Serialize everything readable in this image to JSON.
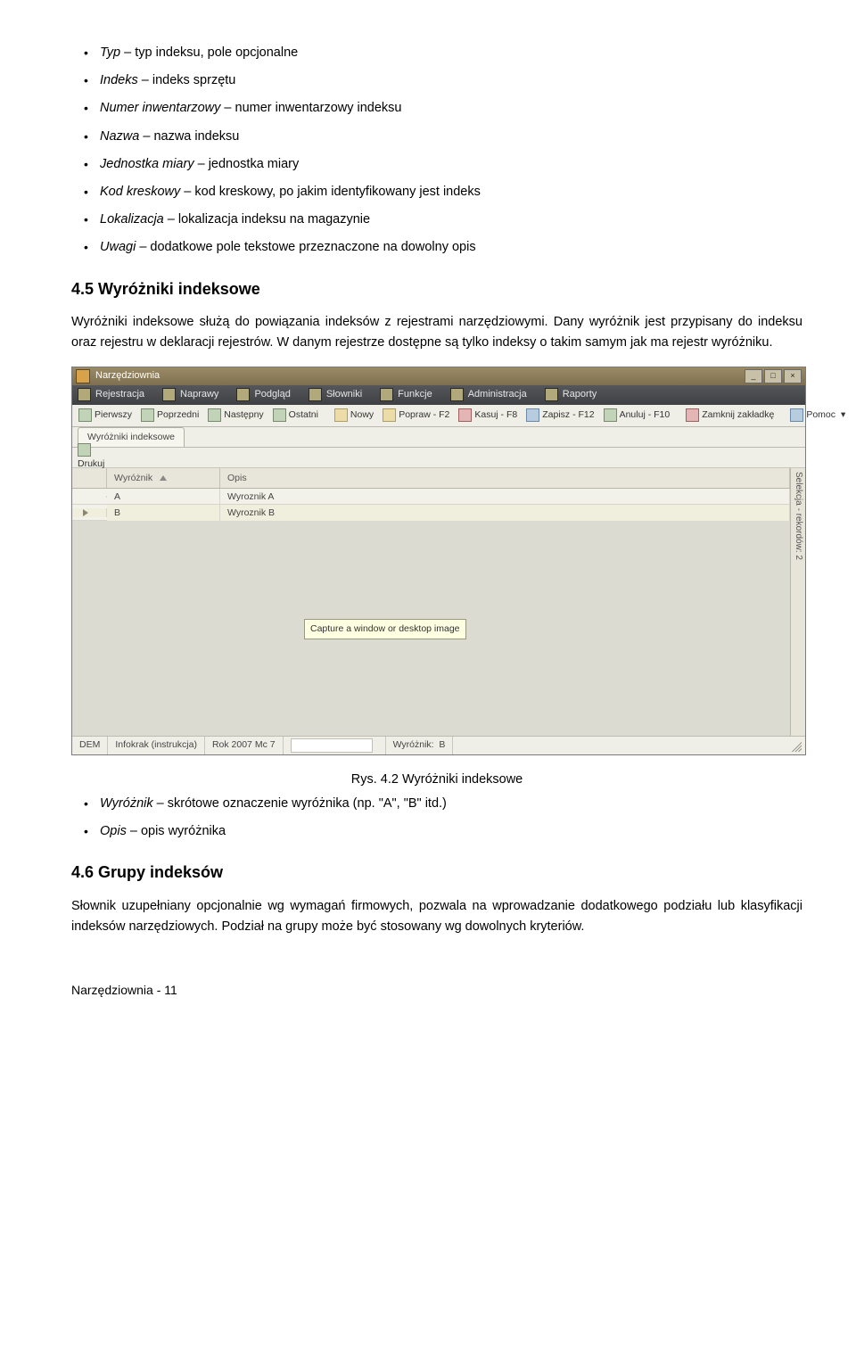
{
  "list1": [
    {
      "term": "Typ",
      "desc": " – typ indeksu, pole opcjonalne"
    },
    {
      "term": "Indeks",
      "desc": " – indeks sprzętu"
    },
    {
      "term": "Numer inwentarzowy",
      "desc": " – numer inwentarzowy indeksu"
    },
    {
      "term": "Nazwa",
      "desc": " – nazwa indeksu"
    },
    {
      "term": "Jednostka miary",
      "desc": " – jednostka miary"
    },
    {
      "term": "Kod kreskowy",
      "desc": " – kod kreskowy, po jakim identyfikowany jest indeks"
    },
    {
      "term": "Lokalizacja",
      "desc": " – lokalizacja indeksu na magazynie"
    },
    {
      "term": "Uwagi",
      "desc": " – dodatkowe pole tekstowe przeznaczone na dowolny opis"
    }
  ],
  "section45_title": "4.5  Wyróżniki indeksowe",
  "section45_body": "Wyróżniki indeksowe służą do powiązania indeksów z rejestrami narzędziowymi. Dany wyróżnik jest przypisany do indeksu oraz rejestru w deklaracji rejestrów. W danym rejestrze dostępne są tylko indeksy o takim samym jak ma rejestr wyróżniku.",
  "app": {
    "title": "Narzędziownia",
    "menu": [
      "Rejestracja",
      "Naprawy",
      "Podgląd",
      "Słowniki",
      "Funkcje",
      "Administracja",
      "Raporty"
    ],
    "toolbar": [
      {
        "label": "Pierwszy"
      },
      {
        "label": "Poprzedni"
      },
      {
        "label": "Następny"
      },
      {
        "label": "Ostatni"
      },
      {
        "label": "Nowy"
      },
      {
        "label": "Popraw - F2"
      },
      {
        "label": "Kasuj - F8"
      },
      {
        "label": "Zapisz - F12"
      },
      {
        "label": "Anuluj - F10"
      },
      {
        "label": "Zamknij zakładkę"
      },
      {
        "label": "Pomoc"
      }
    ],
    "tab": "Wyróżniki indeksowe",
    "print": "Drukuj",
    "columns": {
      "wyroznik": "Wyróżnik",
      "opis": "Opis"
    },
    "rows": [
      {
        "w": "A",
        "o": "Wyroznik A"
      },
      {
        "w": "B",
        "o": "Wyroznik B"
      }
    ],
    "tooltip": "Capture a window or desktop image",
    "side": "Selekcja - rekordów: 2",
    "status": {
      "dem": "DEM",
      "info": "Infokrak (instrukcja)",
      "rok": "Rok 2007 Mc 7",
      "wlabel": "Wyróżnik:",
      "wval": "B"
    }
  },
  "caption": "Rys. 4.2 Wyróżniki indeksowe",
  "list2": [
    {
      "term": "Wyróżnik",
      "desc": " – skrótowe oznaczenie wyróżnika (np. \"A\", \"B\" itd.)"
    },
    {
      "term": "Opis",
      "desc": " – opis wyróżnika"
    }
  ],
  "section46_title": "4.6  Grupy indeksów",
  "section46_body": "Słownik uzupełniany opcjonalnie wg wymagań firmowych, pozwala na wprowadzanie dodatkowego podziału lub klasyfikacji indeksów narzędziowych. Podział na grupy może być stosowany wg dowolnych kryteriów.",
  "footer": "Narzędziownia -  11"
}
